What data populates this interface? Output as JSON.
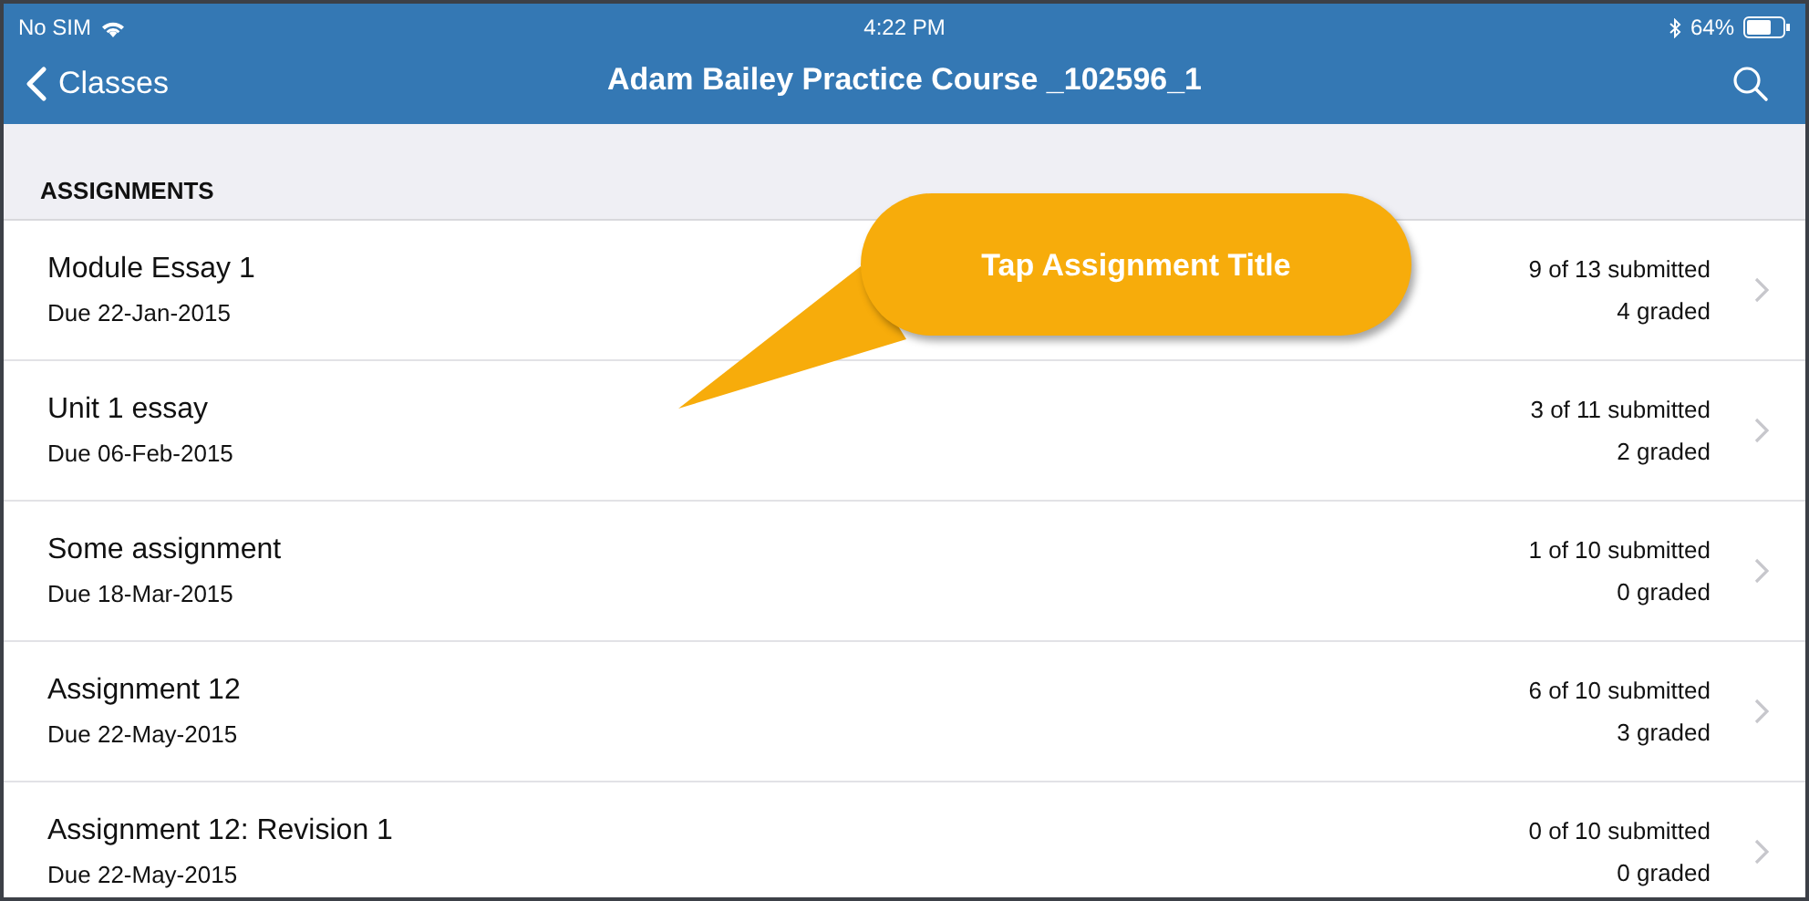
{
  "status_bar": {
    "carrier": "No SIM",
    "time": "4:22 PM",
    "battery": "64%"
  },
  "nav_bar": {
    "back": "Classes",
    "title": "Adam Bailey Practice Course _102596_1"
  },
  "section_header": "ASSIGNMENTS",
  "assignments": [
    {
      "title": "Module Essay 1",
      "due": "Due 22-Jan-2015",
      "submitted": "9 of 13 submitted",
      "graded": "4 graded"
    },
    {
      "title": "Unit 1 essay",
      "due": "Due 06-Feb-2015",
      "submitted": "3 of 11 submitted",
      "graded": "2 graded"
    },
    {
      "title": "Some assignment",
      "due": "Due 18-Mar-2015",
      "submitted": "1 of 10 submitted",
      "graded": "0 graded"
    },
    {
      "title": "Assignment 12",
      "due": "Due 22-May-2015",
      "submitted": "6 of 10 submitted",
      "graded": "3 graded"
    },
    {
      "title": "Assignment 12: Revision 1",
      "due": "Due 22-May-2015",
      "submitted": "0 of 10 submitted",
      "graded": "0 graded"
    }
  ],
  "callout": {
    "text": "Tap Assignment Title"
  }
}
